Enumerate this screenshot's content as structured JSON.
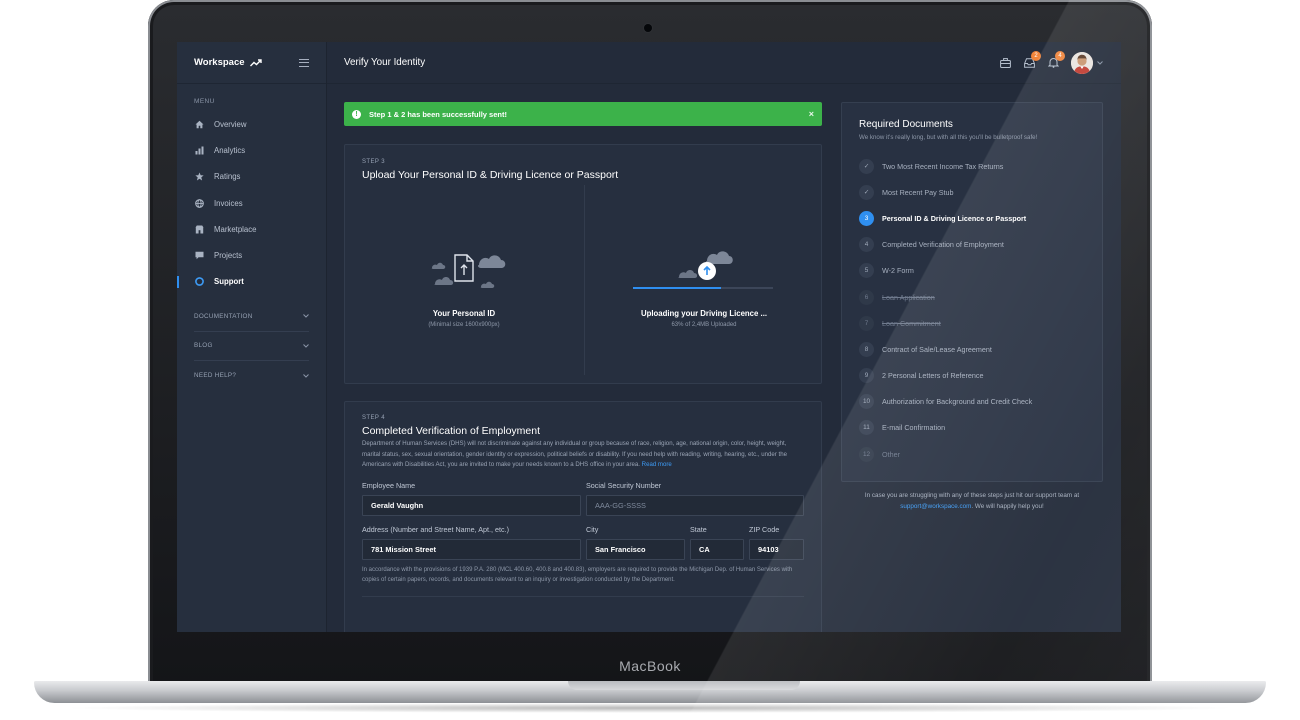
{
  "device": {
    "brand": "MacBook"
  },
  "sidebar": {
    "logo": "Workspace",
    "menu_heading": "MENU",
    "items": [
      {
        "label": "Overview",
        "icon": "home-icon"
      },
      {
        "label": "Analytics",
        "icon": "bar-chart-icon"
      },
      {
        "label": "Ratings",
        "icon": "star-icon"
      },
      {
        "label": "Invoices",
        "icon": "globe-icon"
      },
      {
        "label": "Marketplace",
        "icon": "store-icon"
      },
      {
        "label": "Projects",
        "icon": "chat-icon"
      },
      {
        "label": "Support",
        "icon": "lifebuoy-icon",
        "active": true
      }
    ],
    "sections": [
      {
        "label": "DOCUMENTATION"
      },
      {
        "label": "BLOG"
      },
      {
        "label": "NEED HELP?"
      }
    ]
  },
  "topbar": {
    "title": "Verify Your Identity",
    "icons": [
      {
        "name": "briefcase-icon"
      },
      {
        "name": "inbox-icon",
        "badge": "2"
      },
      {
        "name": "bell-icon",
        "badge": "4"
      }
    ]
  },
  "alert": {
    "text": "Step 1 & 2 has been successfully sent!",
    "close": "×",
    "color": "#3cb24a"
  },
  "step3": {
    "step": "STEP 3",
    "title": "Upload Your Personal ID & Driving Licence or Passport",
    "left": {
      "title": "Your Personal ID",
      "subtitle": "(Minimal size 1600x900px)"
    },
    "right": {
      "title": "Uploading your Driving Licence ...",
      "subtitle": "63% of 2,4MB Uploaded",
      "progress": 0.63
    }
  },
  "step4": {
    "step": "STEP 4",
    "title": "Completed Verification of Employment",
    "description": "Department of Human Services (DHS) will not discriminate against any individual or group because of race, religion, age, national origin, color, height, weight, marital status, sex, sexual orientation, gender identity or expression, political beliefs or disability. If you need help with reading, writing, hearing, etc., under the Americans with Disabilities Act, you are invited to make your needs known to a DHS office in your area.",
    "read_more": "Read more",
    "fields": {
      "employee_name": {
        "label": "Employee Name",
        "value": "Gerald Vaughn"
      },
      "ssn": {
        "label": "Social Security Number",
        "placeholder": "AAA-GG-SSSS"
      },
      "address": {
        "label": "Address (Number and Street Name, Apt., etc.)",
        "value": "781 Mission Street"
      },
      "city": {
        "label": "City",
        "value": "San Francisco"
      },
      "state": {
        "label": "State",
        "value": "CA"
      },
      "zip": {
        "label": "ZIP Code",
        "value": "94103"
      }
    },
    "legal": "In accordance with the provisions of 1939 P.A. 280 (MCL 400.60, 400.8 and 400.83), employers are required to provide the Michigan Dep. of Human Services with copies of certain papers, records, and documents relevant to an inquiry or investigation conducted by the Department."
  },
  "required_docs": {
    "title": "Required Documents",
    "subtitle": "We know it's really long, but with all this you'll be bulletproof safe!",
    "items": [
      {
        "num": "✓",
        "label": "Two Most Recent Income Tax Returns",
        "state": "done"
      },
      {
        "num": "✓",
        "label": "Most Recent Pay Stub",
        "state": "done"
      },
      {
        "num": "3",
        "label": "Personal ID & Driving Licence or Passport",
        "state": "current"
      },
      {
        "num": "4",
        "label": "Completed Verification of Employment",
        "state": "pending"
      },
      {
        "num": "5",
        "label": "W-2 Form",
        "state": "pending"
      },
      {
        "num": "6",
        "label": "Loan Application",
        "state": "struck"
      },
      {
        "num": "7",
        "label": "Loan Commitment",
        "state": "struck"
      },
      {
        "num": "8",
        "label": "Contract of Sale/Lease Agreement",
        "state": "pending"
      },
      {
        "num": "9",
        "label": "2 Personal Letters of Reference",
        "state": "pending"
      },
      {
        "num": "10",
        "label": "Authorization for Background and Credit Check",
        "state": "pending"
      },
      {
        "num": "11",
        "label": "E-mail Confirmation",
        "state": "pending"
      },
      {
        "num": "12",
        "label": "Other",
        "state": "dim"
      }
    ]
  },
  "help": {
    "text_before": "In case you are struggling with any of these steps just hit our support team at",
    "email": "support@workspace.com",
    "text_after": ". We will happily help you!"
  },
  "colors": {
    "accent": "#2f8ff0",
    "success": "#3cb24a",
    "badge": "#f0843a",
    "background": "#232b3a"
  }
}
